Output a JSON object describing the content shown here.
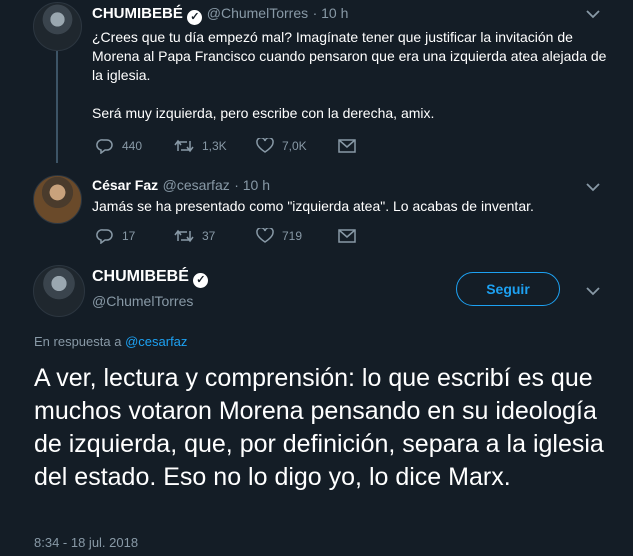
{
  "tweet1": {
    "name": "CHUMIBEBÉ",
    "handle": "@ChumelTorres",
    "time": "· 10 h",
    "text": "¿Crees que tu día empezó mal? Imagínate tener que justificar la invitación de Morena al Papa Francisco cuando pensaron que era una izquierda atea alejada de la iglesia.\n\nSerá muy izquierda, pero escribe con la derecha, amix.",
    "replies": "440",
    "retweets": "1,3K",
    "likes": "7,0K"
  },
  "tweet2": {
    "name": "César Faz",
    "handle": "@cesarfaz",
    "time": "· 10 h",
    "text": "Jamás se ha presentado como \"izquierda atea\". Lo acabas de inventar.",
    "replies": "17",
    "retweets": "37",
    "likes": "719"
  },
  "main": {
    "name": "CHUMIBEBÉ",
    "handle": "@ChumelTorres",
    "follow_label": "Seguir",
    "reply_prefix": "En respuesta a",
    "reply_to": "@cesarfaz",
    "text": "A ver, lectura y comprensión: lo que escribí es que muchos votaron Morena pensando en su ideología de izquierda, que, por definición, separa a la iglesia del estado. Eso no lo digo yo, lo dice Marx.",
    "timestamp": "8:34 - 18 jul. 2018"
  },
  "colors": {
    "background": "#141d26",
    "muted": "#8899a6",
    "accent": "#1da1f2"
  },
  "icons": [
    "reply-icon",
    "retweet-icon",
    "like-icon",
    "message-icon",
    "verified-icon",
    "chevron-down-icon"
  ]
}
